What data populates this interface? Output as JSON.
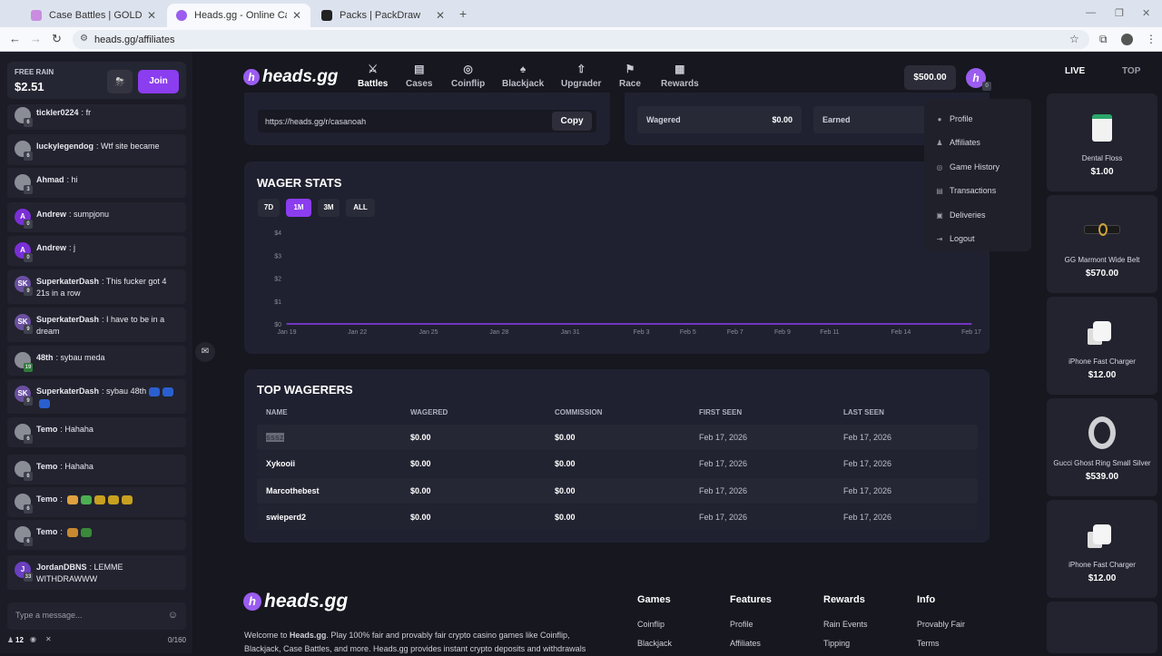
{
  "browser": {
    "tabs": [
      {
        "title": "Case Battles | GOLDPUMP"
      },
      {
        "title": "Heads.gg - Online Case Battles"
      },
      {
        "title": "Packs | PackDraw"
      }
    ],
    "url": "heads.gg/affiliates"
  },
  "chat": {
    "rain_label": "FREE RAIN",
    "rain_amount": "$2.51",
    "join_label": "Join",
    "input_placeholder": "Type a message...",
    "online_count": "12",
    "char_count": "0/160",
    "messages": [
      {
        "user": "tickler0224",
        "text": "fr",
        "level": "6",
        "avatar": ""
      },
      {
        "user": "luckylegendog",
        "text": "Wtf site became",
        "level": "6",
        "avatar": ""
      },
      {
        "user": "Ahmad",
        "text": "hi",
        "level": "3",
        "avatar": ""
      },
      {
        "user": "Andrew",
        "text": "sumpjonu",
        "level": "0",
        "avatar": "A"
      },
      {
        "user": "Andrew",
        "text": "j",
        "level": "0",
        "avatar": "A"
      },
      {
        "user": "SuperkaterDash",
        "text": "This fucker got 4 21s in a row",
        "level": "9",
        "avatar": "SK"
      },
      {
        "user": "SuperkaterDash",
        "text": "I have to be in a dream",
        "level": "9",
        "avatar": "SK"
      },
      {
        "user": "48th",
        "text": "sybau meda",
        "level": "19",
        "avatar": ""
      },
      {
        "user": "SuperkaterDash",
        "text": "sybau 48th",
        "level": "9",
        "avatar": "SK"
      },
      {
        "user": "Temo",
        "text": "Hahaha",
        "level": "6",
        "avatar": ""
      },
      {
        "user": "Temo",
        "text": "Hahaha",
        "level": "6",
        "avatar": ""
      },
      {
        "user": "Temo",
        "text": "",
        "level": "6",
        "avatar": ""
      },
      {
        "user": "Temo",
        "text": "",
        "level": "6",
        "avatar": ""
      },
      {
        "user": "JordanDBNS",
        "text": "LEMME WITHDRAWWW",
        "level": "33",
        "avatar": "J"
      }
    ]
  },
  "header": {
    "logo": "heads.gg",
    "nav": [
      "Battles",
      "Cases",
      "Coinflip",
      "Blackjack",
      "Upgrader",
      "Race",
      "Rewards"
    ],
    "active_nav": "Battles",
    "balance": "$500.00",
    "avatar_letter": "h",
    "avatar_level": "0"
  },
  "referral": {
    "link": "https://heads.gg/r/casanoah",
    "copy_label": "Copy",
    "wagered_label": "Wagered",
    "wagered_value": "$0.00",
    "earned_label": "Earned"
  },
  "wager_stats": {
    "title": "WAGER STATS",
    "ranges": [
      "7D",
      "1M",
      "3M",
      "ALL"
    ],
    "selected_range": "1M"
  },
  "chart_data": {
    "type": "line",
    "title": "",
    "x": [
      "Jan 19",
      "Jan 22",
      "Jan 25",
      "Jan 28",
      "Jan 31",
      "Feb 3",
      "Feb 5",
      "Feb 7",
      "Feb 9",
      "Feb 11",
      "Feb 14",
      "Feb 17"
    ],
    "series": [
      {
        "values": [
          0,
          0,
          0,
          0,
          0,
          0,
          0,
          0,
          0,
          0,
          0,
          0
        ]
      }
    ],
    "ytick_labels": [
      "$0",
      "$1",
      "$2",
      "$3",
      "$4"
    ],
    "ylim": [
      0,
      4
    ],
    "line_color": "#8b3df0",
    "grid": false
  },
  "top_wagerers": {
    "title": "TOP WAGERERS",
    "columns": [
      "NAME",
      "WAGERED",
      "COMMISSION",
      "FIRST SEEN",
      "LAST SEEN"
    ],
    "rows": [
      [
        "sssz",
        "$0.00",
        "$0.00",
        "Feb 17, 2026",
        "Feb 17, 2026"
      ],
      [
        "Xykooii",
        "$0.00",
        "$0.00",
        "Feb 17, 2026",
        "Feb 17, 2026"
      ],
      [
        "Marcothebest",
        "$0.00",
        "$0.00",
        "Feb 17, 2026",
        "Feb 17, 2026"
      ],
      [
        "swieperd2",
        "$0.00",
        "$0.00",
        "Feb 17, 2026",
        "Feb 17, 2026"
      ]
    ]
  },
  "user_menu": [
    "Profile",
    "Affiliates",
    "Game History",
    "Transactions",
    "Deliveries",
    "Logout"
  ],
  "footer": {
    "logo": "heads.gg",
    "desc_brand": "Heads.gg",
    "desc_pre": "Welcome to ",
    "desc_rest": ". Play 100% fair and provably fair crypto casino games like Coinflip, Blackjack, Case Battles, and more. Heads.gg provides instant crypto deposits and withdrawals",
    "columns": [
      {
        "title": "Games",
        "links": [
          "Coinflip",
          "Blackjack"
        ]
      },
      {
        "title": "Features",
        "links": [
          "Profile",
          "Affiliates"
        ]
      },
      {
        "title": "Rewards",
        "links": [
          "Rain Events",
          "Tipping"
        ]
      },
      {
        "title": "Info",
        "links": [
          "Provably Fair",
          "Terms"
        ]
      }
    ]
  },
  "live_feed": {
    "tabs": [
      "LIVE",
      "TOP"
    ],
    "items": [
      {
        "name": "Dental Floss",
        "price": "$1.00"
      },
      {
        "name": "GG Marmont Wide Belt",
        "price": "$570.00"
      },
      {
        "name": "iPhone Fast Charger",
        "price": "$12.00"
      },
      {
        "name": "Gucci Ghost Ring Small Silver",
        "price": "$539.00"
      },
      {
        "name": "iPhone Fast Charger",
        "price": "$12.00"
      }
    ]
  }
}
